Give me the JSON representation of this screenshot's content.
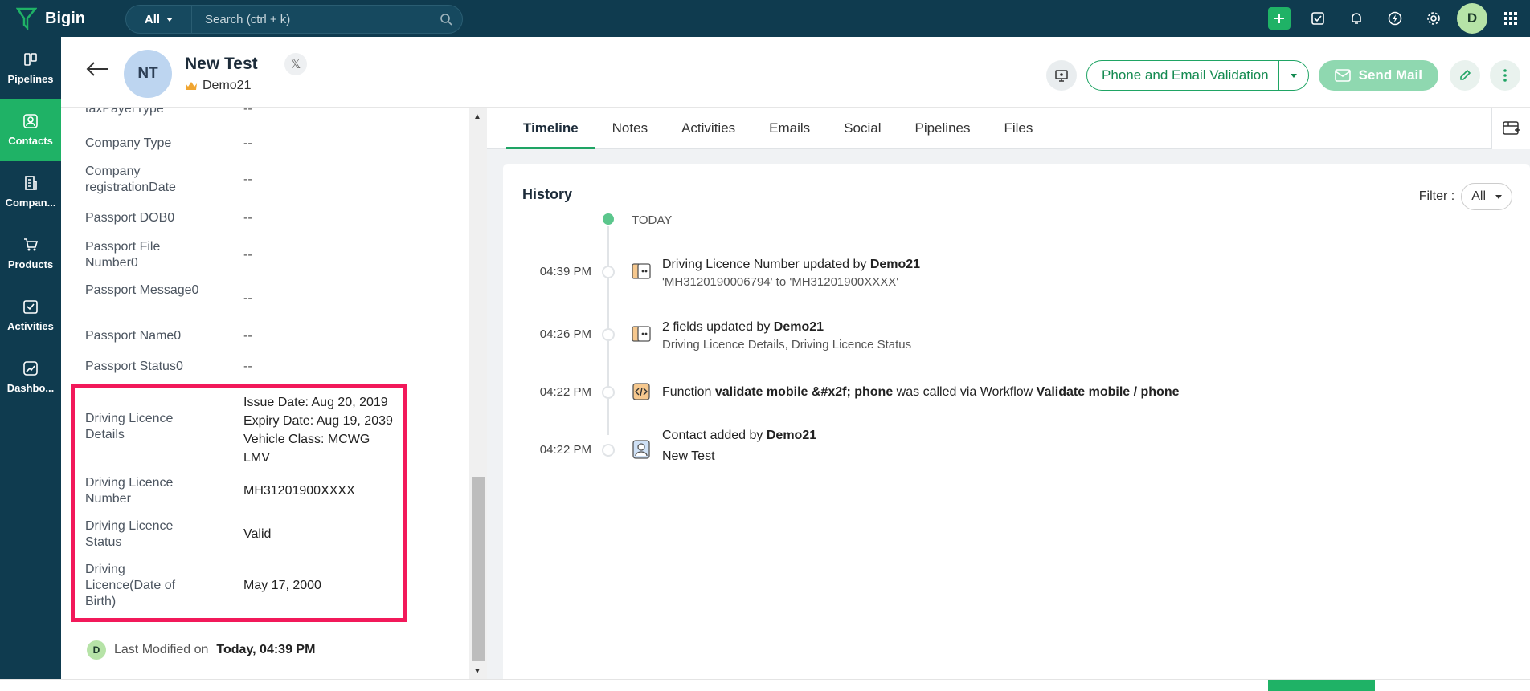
{
  "app": {
    "name": "Bigin"
  },
  "search": {
    "scope": "All",
    "placeholder": "Search (ctrl + k)"
  },
  "topbar": {
    "user_initial": "D"
  },
  "nav": [
    {
      "label": "Pipelines",
      "icon": "pipelines-icon"
    },
    {
      "label": "Contacts",
      "icon": "contacts-icon",
      "active": true
    },
    {
      "label": "Compan...",
      "icon": "companies-icon"
    },
    {
      "label": "Products",
      "icon": "products-icon"
    },
    {
      "label": "Activities",
      "icon": "activities-icon"
    },
    {
      "label": "Dashbo...",
      "icon": "dashboards-icon"
    }
  ],
  "contact": {
    "initials": "NT",
    "name": "New Test",
    "owner": "Demo21"
  },
  "header_actions": {
    "validation": "Phone and Email Validation",
    "send_mail": "Send Mail"
  },
  "fields": [
    {
      "label": "taxPayerType",
      "value": "--"
    },
    {
      "label": "Company Type",
      "value": "--"
    },
    {
      "label": "Company registrationDate",
      "value": "--"
    },
    {
      "label": "Passport DOB0",
      "value": "--"
    },
    {
      "label": "Passport File Number0",
      "value": "--"
    },
    {
      "label": "Passport Message0",
      "value": "--"
    },
    {
      "label": "Passport Name0",
      "value": "--"
    },
    {
      "label": "Passport Status0",
      "value": "--"
    },
    {
      "label": "Driving Licence Details",
      "value_lines": [
        "Issue Date: Aug 20, 2019",
        "Expiry Date: Aug 19, 2039",
        "Vehicle Class: MCWG",
        "LMV"
      ]
    },
    {
      "label": "Driving Licence Number",
      "value": "MH31201900XXXX"
    },
    {
      "label": "Driving Licence Status",
      "value": "Valid"
    },
    {
      "label": "Driving Licence(Date of Birth)",
      "value": "May 17, 2000"
    }
  ],
  "last_modified": {
    "initial": "D",
    "label": "Last Modified on",
    "time": "Today, 04:39 PM"
  },
  "tabs": [
    "Timeline",
    "Notes",
    "Activities",
    "Emails",
    "Social",
    "Pipelines",
    "Files"
  ],
  "history": {
    "title": "History",
    "filter_label": "Filter :",
    "filter_value": "All",
    "today": "TODAY",
    "items": [
      {
        "time": "04:39 PM",
        "text": "Driving Licence Number updated by",
        "bold": "Demo21",
        "sub": "'MH3120190006794' to 'MH31201900XXXX'"
      },
      {
        "time": "04:26 PM",
        "text": "2 fields updated by",
        "bold": "Demo21",
        "sub": "Driving Licence Details, Driving Licence Status"
      },
      {
        "time": "04:22 PM",
        "prefix": "Function",
        "func": "validate mobile &#x2f; phone",
        "mid": "was called via Workflow",
        "workflow": "Validate mobile / phone"
      },
      {
        "time": "04:22 PM",
        "text": "Contact added by",
        "bold": "Demo21",
        "sub": "New Test"
      }
    ]
  },
  "colors": {
    "sidebar": "#0f3b4f",
    "accent": "#1fb266",
    "highlight_box": "#f2195a"
  }
}
